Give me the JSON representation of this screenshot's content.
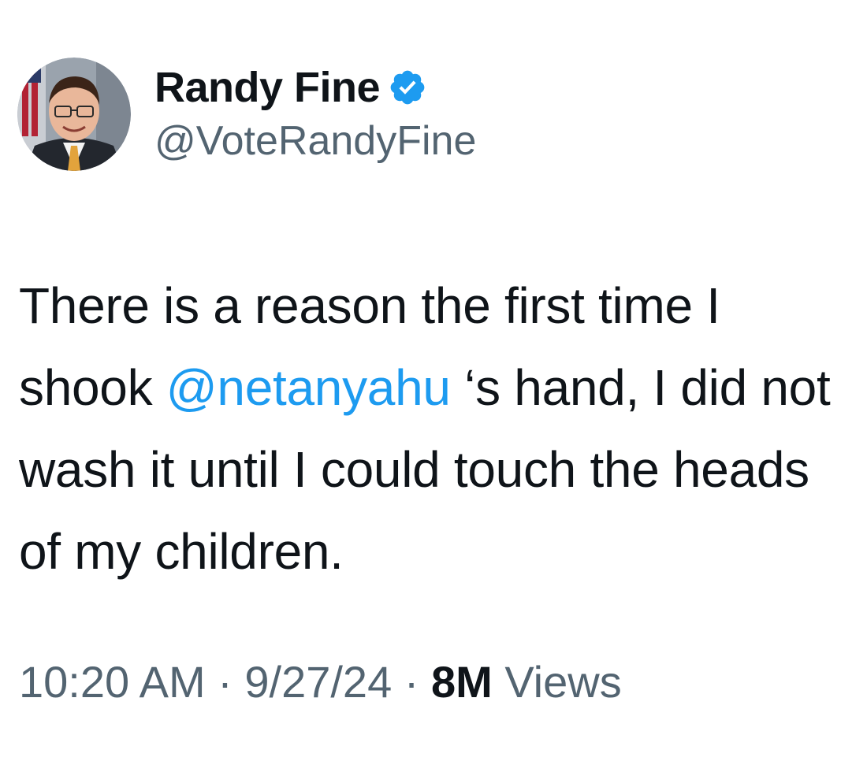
{
  "author": {
    "display_name": "Randy Fine",
    "handle": "@VoteRandyFine",
    "verified": true,
    "verified_color": "#1d9bf0",
    "avatar_icon": "profile-photo"
  },
  "tweet": {
    "text_before_mention": "There is a reason the first time I shook ",
    "mention": "@netanyahu",
    "text_after_mention": " ‘s hand, I did not wash it until I could touch the heads of my children.",
    "mention_color": "#1d9bf0"
  },
  "meta": {
    "time": "10:20 AM",
    "separator": " · ",
    "date": "9/27/24",
    "views_count": "8M",
    "views_label": " Views"
  }
}
